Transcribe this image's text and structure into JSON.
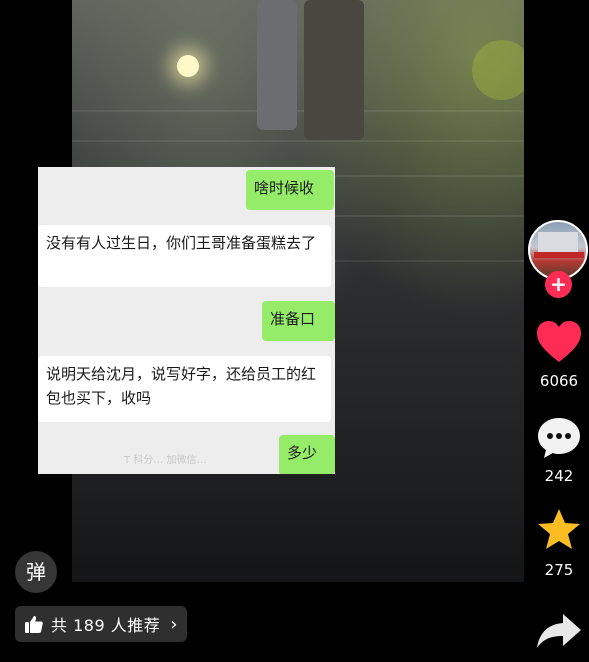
{
  "chat": {
    "msg1": "啥时候收",
    "msg2": "没有有人过生日，你们王哥准备蛋糕去了",
    "msg3": "准备口",
    "msg4": "说明天给沈月，说写好字，还给员工的红包也买下，收吗",
    "msg5": "多少",
    "watermark": "T 科分…  加微信…"
  },
  "actions": {
    "likes": "6066",
    "comments": "242",
    "favorites": "275",
    "follow": "+"
  },
  "bottom": {
    "danmu": "弹",
    "recommend": "共 189 人推荐",
    "chevron": "›"
  },
  "colors": {
    "like": "#fe2c55",
    "favorite": "#fbbd22",
    "bubble_green": "#95ec69"
  }
}
